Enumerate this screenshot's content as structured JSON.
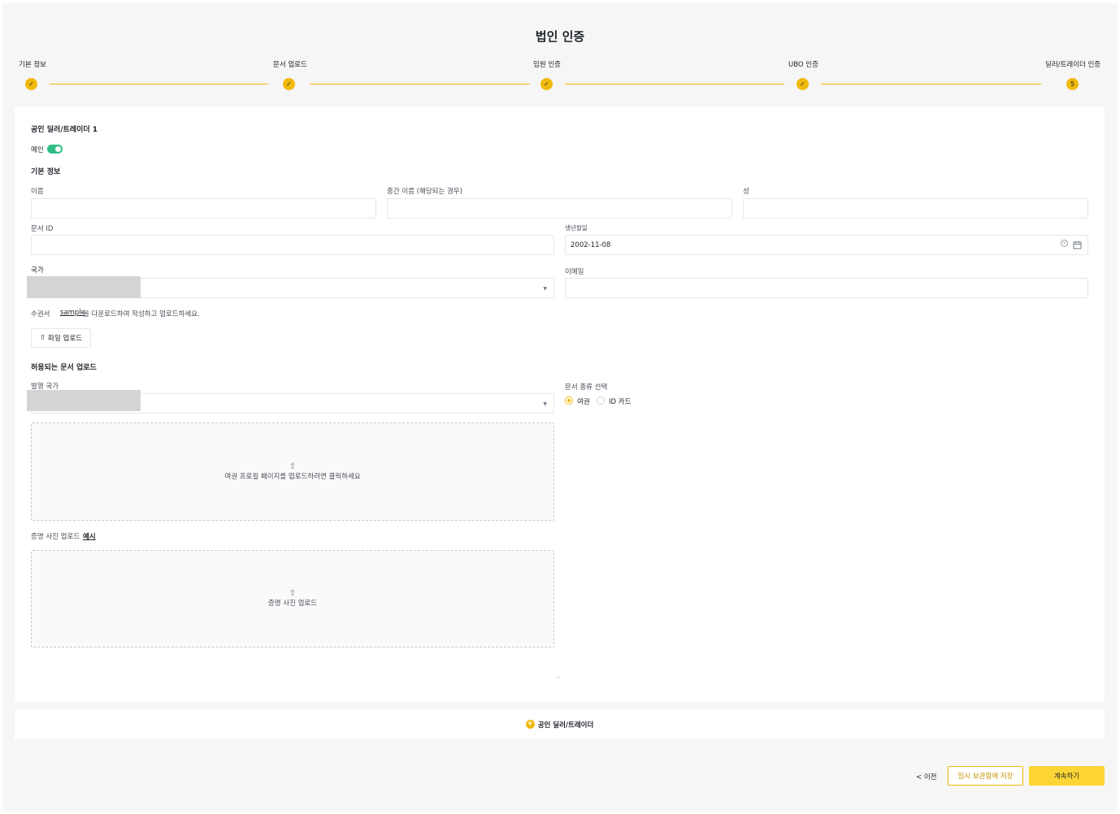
{
  "page_title": "법인 인증",
  "steps": [
    {
      "label": "기본 정보",
      "state": "done",
      "marker": "✓"
    },
    {
      "label": "문서 업로드",
      "state": "done",
      "marker": "✓"
    },
    {
      "label": "임원 인증",
      "state": "done",
      "marker": "✓"
    },
    {
      "label": "UBO 인증",
      "state": "done",
      "marker": "✓"
    },
    {
      "label": "딜러/트레이더 인증",
      "state": "current",
      "marker": "5"
    }
  ],
  "dealer": {
    "title": "공인 딜러/트레이더 1",
    "main_label": "메인",
    "main_on": true,
    "basic_info_title": "기본 정보",
    "fields": {
      "first_name": {
        "label": "이름",
        "value": ""
      },
      "middle_name": {
        "label": "중간 이름 (해당되는 경우)",
        "value": ""
      },
      "last_name": {
        "label": "성",
        "value": ""
      },
      "document_id": {
        "label": "문서 ID",
        "value": ""
      },
      "birth_date": {
        "label": "생년월일",
        "value": "2002-11-08"
      },
      "country": {
        "label": "국가",
        "value": ""
      },
      "email": {
        "label": "이메일",
        "value": ""
      }
    },
    "power_of_attorney": {
      "label": "수권서",
      "sample_link": "sample",
      "instruction": "을 다운로드하여 작성하고 업로드하세요.",
      "upload_button": "파일 업로드"
    },
    "allowed_docs": {
      "title": "허용되는 문서 업로드",
      "issuing_country_label": "발행 국가",
      "doc_type_label": "문서 종류 선택",
      "doc_types": [
        {
          "label": "여권",
          "selected": true
        },
        {
          "label": "ID 카드",
          "selected": false
        }
      ],
      "passport_dropzone": "여권 프로필 페이지를 업로드하려면 클릭하세요",
      "selfie_label": "증명 사진 업로드",
      "selfie_example": "예시",
      "selfie_dropzone": "증명 사진 업로드"
    }
  },
  "add_dealer_button": "공인 딜러/트레이더",
  "footer": {
    "prev": "< 이전",
    "save_draft": "임시 보관함에 저장",
    "continue": "계속하기"
  },
  "colors": {
    "accent": "#f0b90b",
    "toggle_on": "#2ebd85",
    "primary_button": "#fcd535"
  }
}
